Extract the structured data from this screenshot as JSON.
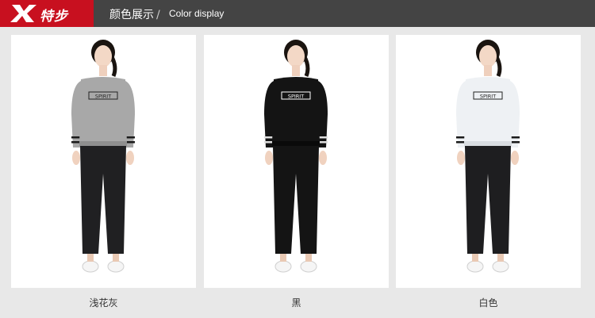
{
  "header": {
    "logo_text": "特步",
    "title_cn": "颜色展示",
    "title_en": "Color display",
    "slash": "/"
  },
  "products": [
    {
      "caption": "浅花灰",
      "shirt_color": "#a8a8a8",
      "shirt_trim": "#8f8f8f",
      "pants_color": "#202022",
      "print_text": "SPIRIT"
    },
    {
      "caption": "黑",
      "shirt_color": "#141414",
      "shirt_trim": "#0a0a0a",
      "pants_color": "#141414",
      "print_text": "SPIRIT"
    },
    {
      "caption": "白色",
      "shirt_color": "#eef1f4",
      "shirt_trim": "#d9dde1",
      "pants_color": "#1e1e20",
      "print_text": "SPIRIT"
    }
  ],
  "colors": {
    "brand_red": "#c8101f",
    "header_bg": "#444444",
    "page_bg": "#e8e8e8"
  }
}
